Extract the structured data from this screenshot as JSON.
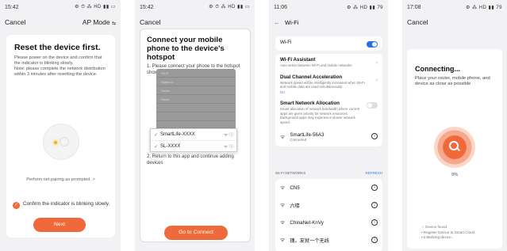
{
  "screen1": {
    "status_time": "15:42",
    "status_icons": "⚙ ⏱ ⁂ HD ▮▮ ▭",
    "cancel": "Cancel",
    "mode": "AP Mode",
    "mode_arrow": "⇆",
    "title": "Reset the device first.",
    "description": "Please power on the device and confirm that the indicator is blinking slowly.\nNote: please complete the network distribution within 3 minutes after resetting the device.",
    "prompt": "Perform net pairing as prompted.",
    "prompt_arrow": ">",
    "confirm": "Confirm the indicator is blinking slowly.",
    "next": "Next"
  },
  "screen2": {
    "status_time": "15:42",
    "status_icons": "⚙ ⏱ ⁂ HD ▮▮ ▭",
    "cancel": "Cancel",
    "title": "Connect your mobile phone to the device's hotspot",
    "step1": "1. Please connect your phone to the hotspot shown below",
    "shot_rows": [
      "Wi-Fi",
      "Sigmo.io",
      "Home",
      "Home",
      "",
      "",
      "",
      "Guest",
      "Guest"
    ],
    "popup_items": [
      "SmartLife-XXXX",
      "SL-XXXX"
    ],
    "step2": "2. Return to this app and continue adding devices",
    "go_button": "Go to Connect"
  },
  "screen3": {
    "status_time": "11:06",
    "status_icons": "⚙ ⁂ HD ▮▮ 79",
    "back_icon": "←",
    "title": "Wi-Fi",
    "wifi_label": "Wi-Fi",
    "wifi_assistant": "Wi-Fi Assistant",
    "wifi_assistant_sub": "Auto select between Wi-Fi and mobile networks",
    "dual_channel": "Dual Channel Acceleration",
    "dual_channel_sub": "Network speed will be intelligently increased when Wi-Fi and mobile data are used simultaneously.",
    "dual_channel_link": "Go",
    "smart_alloc": "Smart Network Allocation",
    "smart_alloc_sub": "Smart allocation of network bandwidth where current apps are given priority for network resources. Background apps may experience slower network speed.",
    "connected_name": "SmartLife-56A3",
    "connected_status": "Connected",
    "networks_header": "WI-FI NETWORKS",
    "refresh": "REFRESH",
    "networks": [
      "CN5",
      "六楼",
      "ChinaNet-KnVy",
      "瑰。友就一个无线"
    ]
  },
  "screen4": {
    "status_time": "17:08",
    "status_icons": "⚙ ⁂ HD ▮▮ 79",
    "cancel": "Cancel",
    "title": "Connecting...",
    "description": "Place your router, mobile phone, and device as close as possible",
    "percent": "9%",
    "steps": [
      "Device found",
      "Register Device to Smart Cloud",
      "Initializing device..."
    ]
  },
  "colors": {
    "accent": "#f0693b",
    "link": "#3a7bd5",
    "toggle_on": "#2b6ee0"
  }
}
